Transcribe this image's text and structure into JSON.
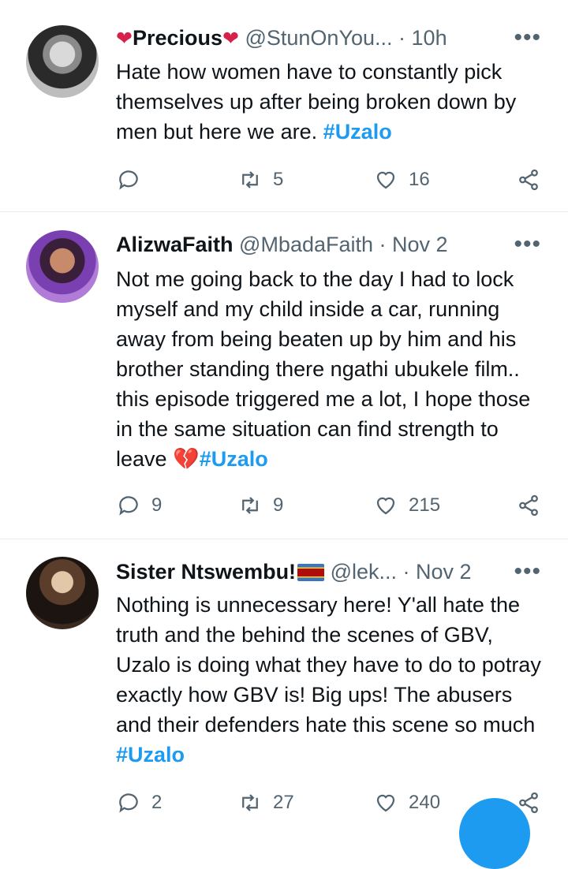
{
  "tweets": [
    {
      "name": "Precious",
      "handle": "@StunOnYou...",
      "time": "· 10h",
      "text": "Hate how women have to constantly pick themselves up after being broken down by men but here we are.",
      "hashtag": "#Uzalo",
      "replies": "",
      "retweets": "5",
      "likes": "16"
    },
    {
      "name": "AlizwaFaith",
      "handle": "@MbadaFaith",
      "time": "· Nov 2",
      "text": "Not me going back to the day I had to lock myself and my child inside a car, running away from being beaten up by him and his brother standing there ngathi ubukele film.. this episode triggered me a lot, I hope those in the same situation can find strength to leave",
      "hashtag": "#Uzalo",
      "replies": "9",
      "retweets": "9",
      "likes": "215"
    },
    {
      "name": "Sister Ntswembu!",
      "handle": "@lek...",
      "time": "· Nov 2",
      "text": "Nothing is unnecessary here! Y'all hate the truth and the behind the scenes of GBV, Uzalo is doing what they have to do to potray exactly how GBV is! Big ups! The abusers and their defenders hate this scene so much",
      "hashtag": "#Uzalo",
      "replies": "2",
      "retweets": "27",
      "likes": "240"
    }
  ],
  "icons": {
    "more": "more-horizontal-icon",
    "reply": "reply-icon",
    "retweet": "retweet-icon",
    "like": "heart-icon",
    "share": "share-icon",
    "heart_emoji": "❤",
    "broken_heart_emoji": "💔"
  },
  "colors": {
    "accent": "#1d9bf0",
    "heart": "#d6224a",
    "secondary": "#536471"
  }
}
